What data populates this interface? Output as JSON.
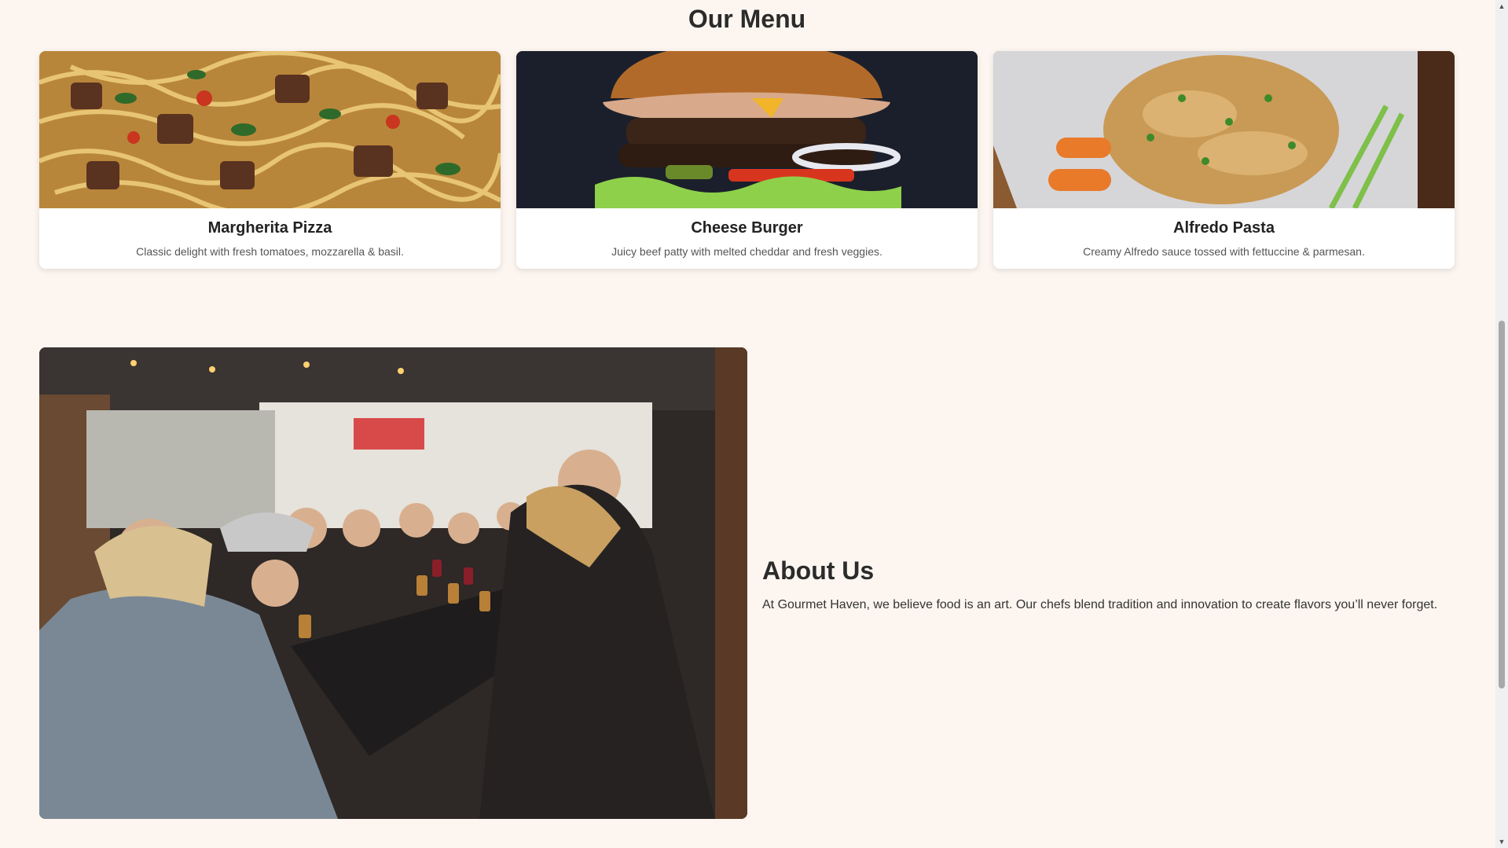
{
  "menu": {
    "title": "Our Menu",
    "items": [
      {
        "name": "Margherita Pizza",
        "description": "Classic delight with fresh tomatoes, mozzarella & basil.",
        "image": "pasta-with-beef-photo"
      },
      {
        "name": "Cheese Burger",
        "description": "Juicy beef patty with melted cheddar and fresh veggies.",
        "image": "cheese-burger-photo"
      },
      {
        "name": "Alfredo Pasta",
        "description": "Creamy Alfredo sauce tossed with fettuccine & parmesan.",
        "image": "fried-rice-photo"
      }
    ]
  },
  "about": {
    "title": "About Us",
    "body": "At Gourmet Haven, we believe food is an art. Our chefs blend tradition and innovation to create flavors you’ll never forget.",
    "image": "diners-at-long-table-photo"
  },
  "colors": {
    "background": "#fdf6f0",
    "card": "#ffffff",
    "text": "#2b2b2b"
  },
  "icons": {
    "scroll_up": "scroll-up-arrow-icon",
    "scroll_down": "scroll-down-arrow-icon"
  }
}
